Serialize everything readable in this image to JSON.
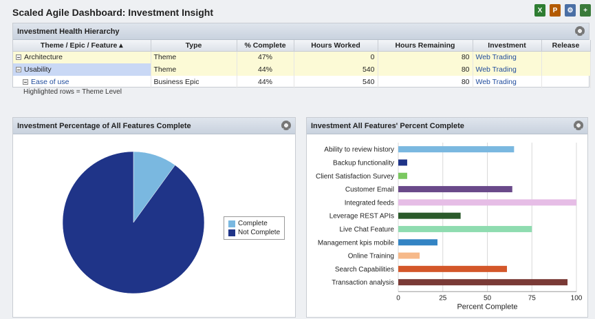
{
  "app": {
    "title": "Scaled Agile Dashboard: Investment Insight"
  },
  "toolbar": [
    {
      "name": "excel-export-icon",
      "glyph": "X",
      "color": "#2e7d32"
    },
    {
      "name": "pdf-export-icon",
      "glyph": "P",
      "color": "#b35a00"
    },
    {
      "name": "configure-icon",
      "glyph": "⚙",
      "color": "#4a6fa5"
    },
    {
      "name": "add-panel-icon",
      "glyph": "+",
      "color": "#3a7a3a"
    }
  ],
  "hierarchy": {
    "title": "Investment Health Hierarchy",
    "columns": [
      "Theme / Epic / Feature ▴",
      "Type",
      "% Complete",
      "Hours Worked",
      "Hours Remaining",
      "Investment",
      "Release"
    ],
    "rows": [
      {
        "name": "Architecture",
        "type": "Theme",
        "complete": "47%",
        "worked": "0",
        "remaining": "80",
        "investment": "Web Trading",
        "release": ""
      },
      {
        "name": "Usability",
        "type": "Theme",
        "complete": "44%",
        "worked": "540",
        "remaining": "80",
        "investment": "Web Trading",
        "release": ""
      },
      {
        "name": "Ease of use",
        "type": "Business Epic",
        "complete": "44%",
        "worked": "540",
        "remaining": "80",
        "investment": "Web Trading",
        "release": ""
      }
    ],
    "note": "Highlighted rows = Theme Level"
  },
  "pie_panel": {
    "title": "Investment Percentage of All Features Complete"
  },
  "bar_panel": {
    "title": "Investment All Features' Percent Complete"
  },
  "chart_data": [
    {
      "type": "pie",
      "categories": [
        "Complete",
        "Not Complete"
      ],
      "values": [
        10,
        90
      ],
      "colors": [
        "#7ab8e0",
        "#1f3488"
      ],
      "legend": "right"
    },
    {
      "type": "bar",
      "orientation": "horizontal",
      "categories": [
        "Ability to review history",
        "Backup functionality",
        "Client Satisfaction Survey",
        "Customer Email",
        "Integrated feeds",
        "Leverage REST APIs",
        "Live Chat Feature",
        "Management kpis mobile",
        "Online Training",
        "Search Capabilities",
        "Transaction analysis"
      ],
      "values": [
        65,
        5,
        5,
        64,
        100,
        35,
        75,
        22,
        12,
        61,
        95
      ],
      "colors": [
        "#7ab8e0",
        "#1f3488",
        "#7ac860",
        "#6a4a8a",
        "#e6bde6",
        "#2b5a2b",
        "#8fdcb0",
        "#3384c4",
        "#f6b98a",
        "#d4572a",
        "#7a3a36"
      ],
      "xlabel": "Percent Complete",
      "xlim": [
        0,
        100
      ],
      "xticks": [
        0,
        25,
        50,
        75,
        100
      ],
      "grid": true
    }
  ]
}
